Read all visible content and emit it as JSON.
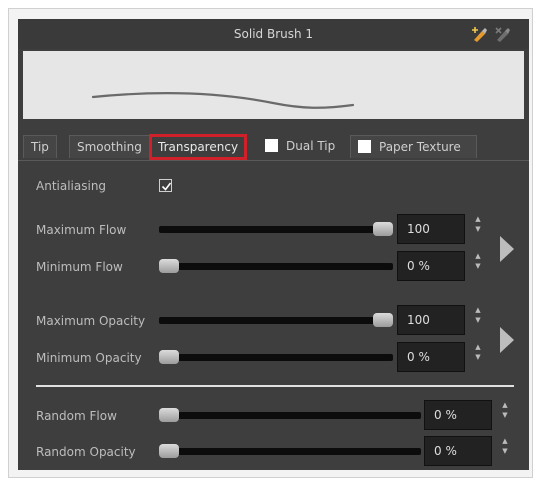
{
  "panel": {
    "title": "Solid Brush 1"
  },
  "header_icons": [
    "brush-add-icon",
    "brush-delete-icon"
  ],
  "tabs": [
    {
      "label": "Tip"
    },
    {
      "label": "Smoothing"
    },
    {
      "label": "Transparency",
      "active": true
    },
    {
      "label": "Dual Tip",
      "checkbox": false
    },
    {
      "label": "Paper Texture",
      "checkbox": false
    }
  ],
  "antialiasing": {
    "label": "Antialiasing",
    "checked": true
  },
  "flow": {
    "max": {
      "label": "Maximum Flow",
      "value": "100",
      "level": 1.0
    },
    "min": {
      "label": "Minimum Flow",
      "value": "0 %",
      "level": 0.0
    }
  },
  "opacity": {
    "max": {
      "label": "Maximum Opacity",
      "value": "100",
      "level": 1.0
    },
    "min": {
      "label": "Minimum Opacity",
      "value": "0 %",
      "level": 0.0
    }
  },
  "random": {
    "flow": {
      "label": "Random Flow",
      "value": "0 %",
      "level": 0.0
    },
    "opacity": {
      "label": "Random Opacity",
      "value": "0 %",
      "level": 0.0
    }
  },
  "colors": {
    "highlight": "#d0202a",
    "panel": "#3e3e3e"
  }
}
